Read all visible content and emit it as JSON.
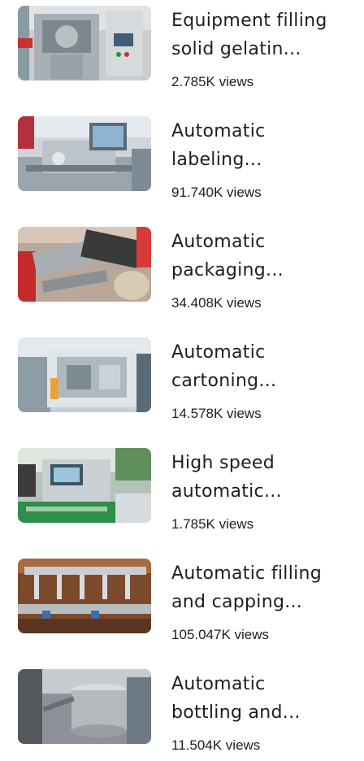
{
  "videos": [
    {
      "title_line1": "Equipment filling",
      "title_line2": "solid gelatin...",
      "views": "2.785K views",
      "thumbnail": "capsule-filling-machine"
    },
    {
      "title_line1": "Automatic",
      "title_line2": "labeling...",
      "views": "91.740K views",
      "thumbnail": "labeling-machine"
    },
    {
      "title_line1": "Automatic",
      "title_line2": "packaging...",
      "views": "34.408K views",
      "thumbnail": "packaging-machine"
    },
    {
      "title_line1": "Automatic",
      "title_line2": "cartoning...",
      "views": "14.578K views",
      "thumbnail": "cartoning-machine"
    },
    {
      "title_line1": "High speed",
      "title_line2": "automatic...",
      "views": "1.785K views",
      "thumbnail": "high-speed-machine"
    },
    {
      "title_line1": "Automatic filling",
      "title_line2": "and capping...",
      "views": "105.047K views",
      "thumbnail": "filling-capping-machine"
    },
    {
      "title_line1": "Automatic",
      "title_line2": "bottling and...",
      "views": "11.504K views",
      "thumbnail": "bottling-machine"
    }
  ]
}
